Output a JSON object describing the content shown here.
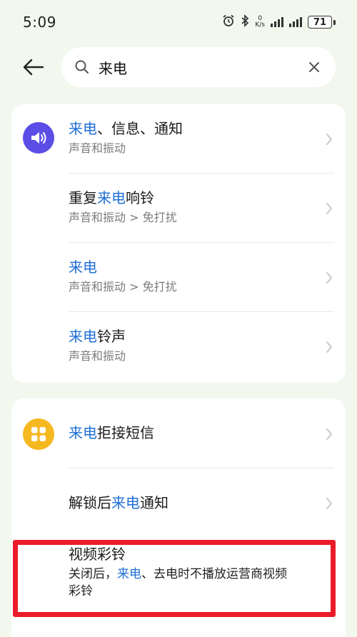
{
  "status_bar": {
    "time": "5:09",
    "net_speed_value": "0",
    "net_speed_unit": "K/s",
    "battery": "71"
  },
  "search": {
    "query": "来电",
    "placeholder": ""
  },
  "results_group1": [
    {
      "title_hl": "来电",
      "title_rest": "、信息、通知",
      "subtitle": "声音和振动",
      "icon": "speaker-icon"
    },
    {
      "title_pre": "重复",
      "title_hl": "来电",
      "title_rest": "响铃",
      "subtitle": "声音和振动 > 免打扰"
    },
    {
      "title_hl": "来电",
      "subtitle": "声音和振动 > 免打扰"
    },
    {
      "title_hl": "来电",
      "title_rest": "铃声",
      "subtitle": "声音和振动"
    }
  ],
  "results_group2": [
    {
      "title_hl": "来电",
      "title_rest": "拒接短信",
      "icon": "apps-grid-icon"
    },
    {
      "title_pre": "解锁后",
      "title_hl": "来电",
      "title_rest": "通知"
    },
    {
      "title": "视频彩铃",
      "desc_pre": "关闭后，",
      "desc_hl": "来电",
      "desc_rest": "、去电时不播放运营商视频",
      "desc_line2": "彩铃"
    }
  ],
  "colors": {
    "highlight_text": "#1f6fd6",
    "speaker_icon_bg": "#5b4ee6",
    "apps_icon_bg": "#f6b820",
    "annotation_box": "#ea1c2a"
  }
}
